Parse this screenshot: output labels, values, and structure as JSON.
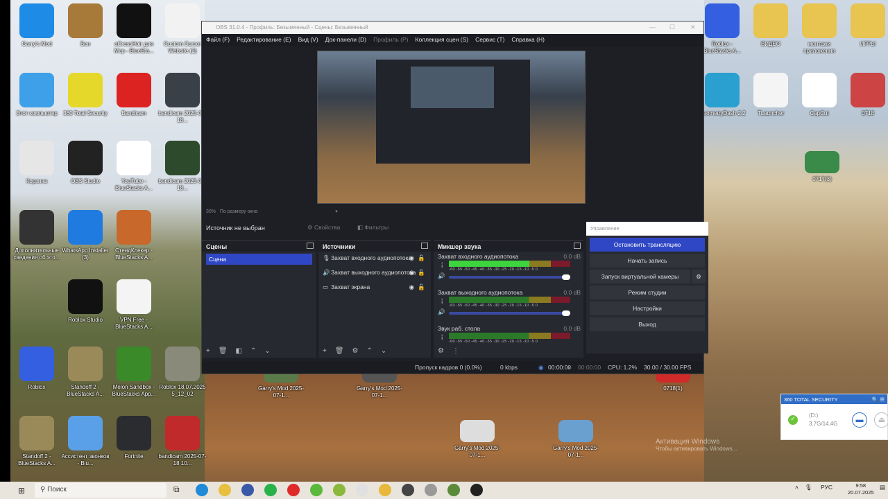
{
  "desktop_left": [
    {
      "label": "Garry's Mod",
      "color": "#1e8be6"
    },
    {
      "label": "Бен",
      "color": "#a87a3a"
    },
    {
      "label": "aCrossHair для Mcp - BlueSta...",
      "color": "#111"
    },
    {
      "label": "Custom Cursor Website (2)",
      "color": "#f2f2f2"
    },
    {
      "label": "Этот компьютер",
      "color": "#3ea0e8"
    },
    {
      "label": "360 Total Security",
      "color": "#e6d82a"
    },
    {
      "label": "Bandicam",
      "color": "#d22"
    },
    {
      "label": "bandicam 2025-07-18...",
      "color": "#3a4048"
    },
    {
      "label": "Корзина",
      "color": "#e6e6e6"
    },
    {
      "label": "OBS Studio",
      "color": "#222"
    },
    {
      "label": "YouTube - BlueStacks A...",
      "color": "#fff"
    },
    {
      "label": "bandicam 2025-07-18...",
      "color": "#2d4a2d"
    },
    {
      "label": "Дополнительные сведения об это...",
      "color": "#333"
    },
    {
      "label": "WhatsApp Installer (3)",
      "color": "#1f7be0"
    },
    {
      "label": "СтендКлекер - BlueStacks A...",
      "color": "#c8682a"
    },
    {
      "label": "",
      "color": "transparent"
    },
    {
      "label": "",
      "color": "transparent"
    },
    {
      "label": "Roblox Studio",
      "color": "#111"
    },
    {
      "label": "VPN Free - BlueStacks A...",
      "color": "#f4f4f4"
    },
    {
      "label": "",
      "color": "transparent"
    },
    {
      "label": "Roblox",
      "color": "#335fe0"
    },
    {
      "label": "Standoff 2 - BlueStacks A...",
      "color": "#9a8a5a"
    },
    {
      "label": "Melon Sandbox - BlueStacks App...",
      "color": "#3a8a2a"
    },
    {
      "label": "Roblox 18.07.2025 5_12_02",
      "color": "#8a8a7a"
    },
    {
      "label": "Standoff 2 - BlueStacks A...",
      "color": "#9a8a5a"
    },
    {
      "label": "Ассистент звонков - Blu...",
      "color": "#5aa0e8"
    },
    {
      "label": "Fortnite",
      "color": "#2a2c30"
    },
    {
      "label": "bandicam 2025-07-18 10...",
      "color": "#c02a2a"
    }
  ],
  "desktop_right": [
    {
      "label": "Roblox - BlueStacks A...",
      "color": "#335fe0"
    },
    {
      "label": "ВИДЕО",
      "color": "#e8c450"
    },
    {
      "label": "монтажи приложения",
      "color": "#e8c450"
    },
    {
      "label": "ИГРЫ",
      "color": "#e8c450"
    },
    {
      "label": "GeometryDash 2.2",
      "color": "#2aa0d0"
    },
    {
      "label": "TLauncher",
      "color": "#f4f4f4"
    },
    {
      "label": "CapCut",
      "color": "#fff"
    },
    {
      "label": "0718",
      "color": "#cc4444"
    }
  ],
  "desktop_misc": [
    {
      "label": "0717(3)",
      "color": "#3a8a4a"
    },
    {
      "label": "Garry's Mod 2025-07-1...",
      "color": "#5a7a4a"
    },
    {
      "label": "Garry's Mod 2025-07-1...",
      "color": "#555"
    },
    {
      "label": "0718(1)",
      "color": "#d02a2a"
    },
    {
      "label": "Garry's Mod 2025-07-1...",
      "color": "#ddd"
    },
    {
      "label": "Garry's Mod 2025-07-1...",
      "color": "#6aa0d0"
    }
  ],
  "obs": {
    "title": "OBS 31.0.4 - Профиль: Безымянный - Сцены: Безымянный",
    "menu": [
      "Файл (F)",
      "Редактирование (E)",
      "Вид (V)",
      "Док-панели (D)",
      "Профиль (P)",
      "Коллекция сцен (S)",
      "Сервис (T)",
      "Справка (H)"
    ],
    "zoom": "30%",
    "zoom_mode": "По размеру окна",
    "no_source": "Источник не выбран",
    "properties": "Свойства",
    "filters": "Фильтры",
    "scenes_title": "Сцены",
    "scene": "Сцена",
    "sources_title": "Источники",
    "sources": [
      "Захват входного аудиопотока",
      "Захват выходного аудиопотока",
      "Захват экрана"
    ],
    "mixer_title": "Микшер звука",
    "mixer": [
      {
        "name": "Захват входного аудиопотока",
        "db": "0.0 dB",
        "level": 0.66
      },
      {
        "name": "Захват выходного аудиопотока",
        "db": "0.0 dB",
        "level": 0
      },
      {
        "name": "Звук раб. стола",
        "db": "0.0 dB",
        "level": 0
      }
    ],
    "ticks": "-60 -55 -50 -45 -40 -35 -30 -25 -20 -15 -10 -5 0",
    "controls_title": "Управление",
    "controls": [
      "Остановить трансляцию",
      "Начать запись",
      "Запуск виртуальной камеры",
      "Режим студии",
      "Настройки",
      "Выход"
    ],
    "status": {
      "dropped": "Пропуск кадров 0 (0.0%)",
      "kbps": "0 kbps",
      "stream_time": "00:00:00",
      "rec_time": "00:00:00",
      "cpu": "CPU: 1.2%",
      "fps": "30.00 / 30.00 FPS"
    }
  },
  "popup": {
    "title": "360 TOTAL SECURITY",
    "drive": "(D:)",
    "size": "3.7G/14.4G"
  },
  "watermark": {
    "line1": "Активация Windows",
    "line2": "Чтобы активировать Windows..."
  },
  "taskbar": {
    "search": "Поиск",
    "lang": "РУС",
    "time": "9:58",
    "date": "20.07.2025",
    "apps": [
      {
        "name": "edge",
        "color": "#1f8ad8"
      },
      {
        "name": "explorer",
        "color": "#e8c040"
      },
      {
        "name": "yandex-browser",
        "color": "#3a5aa8"
      },
      {
        "name": "whatsapp",
        "color": "#2ab24a"
      },
      {
        "name": "yandex",
        "color": "#e02a2a"
      },
      {
        "name": "utorrent",
        "color": "#5ab83a"
      },
      {
        "name": "bluestacks",
        "color": "#8ab83a"
      },
      {
        "name": "capcut-x",
        "color": "#e0e0e0"
      },
      {
        "name": "brawl",
        "color": "#e8b83a"
      },
      {
        "name": "world-of-tanks",
        "color": "#444"
      },
      {
        "name": "compass",
        "color": "#999"
      },
      {
        "name": "minecraft",
        "color": "#5a8a3a"
      },
      {
        "name": "obs",
        "color": "#222"
      }
    ]
  }
}
